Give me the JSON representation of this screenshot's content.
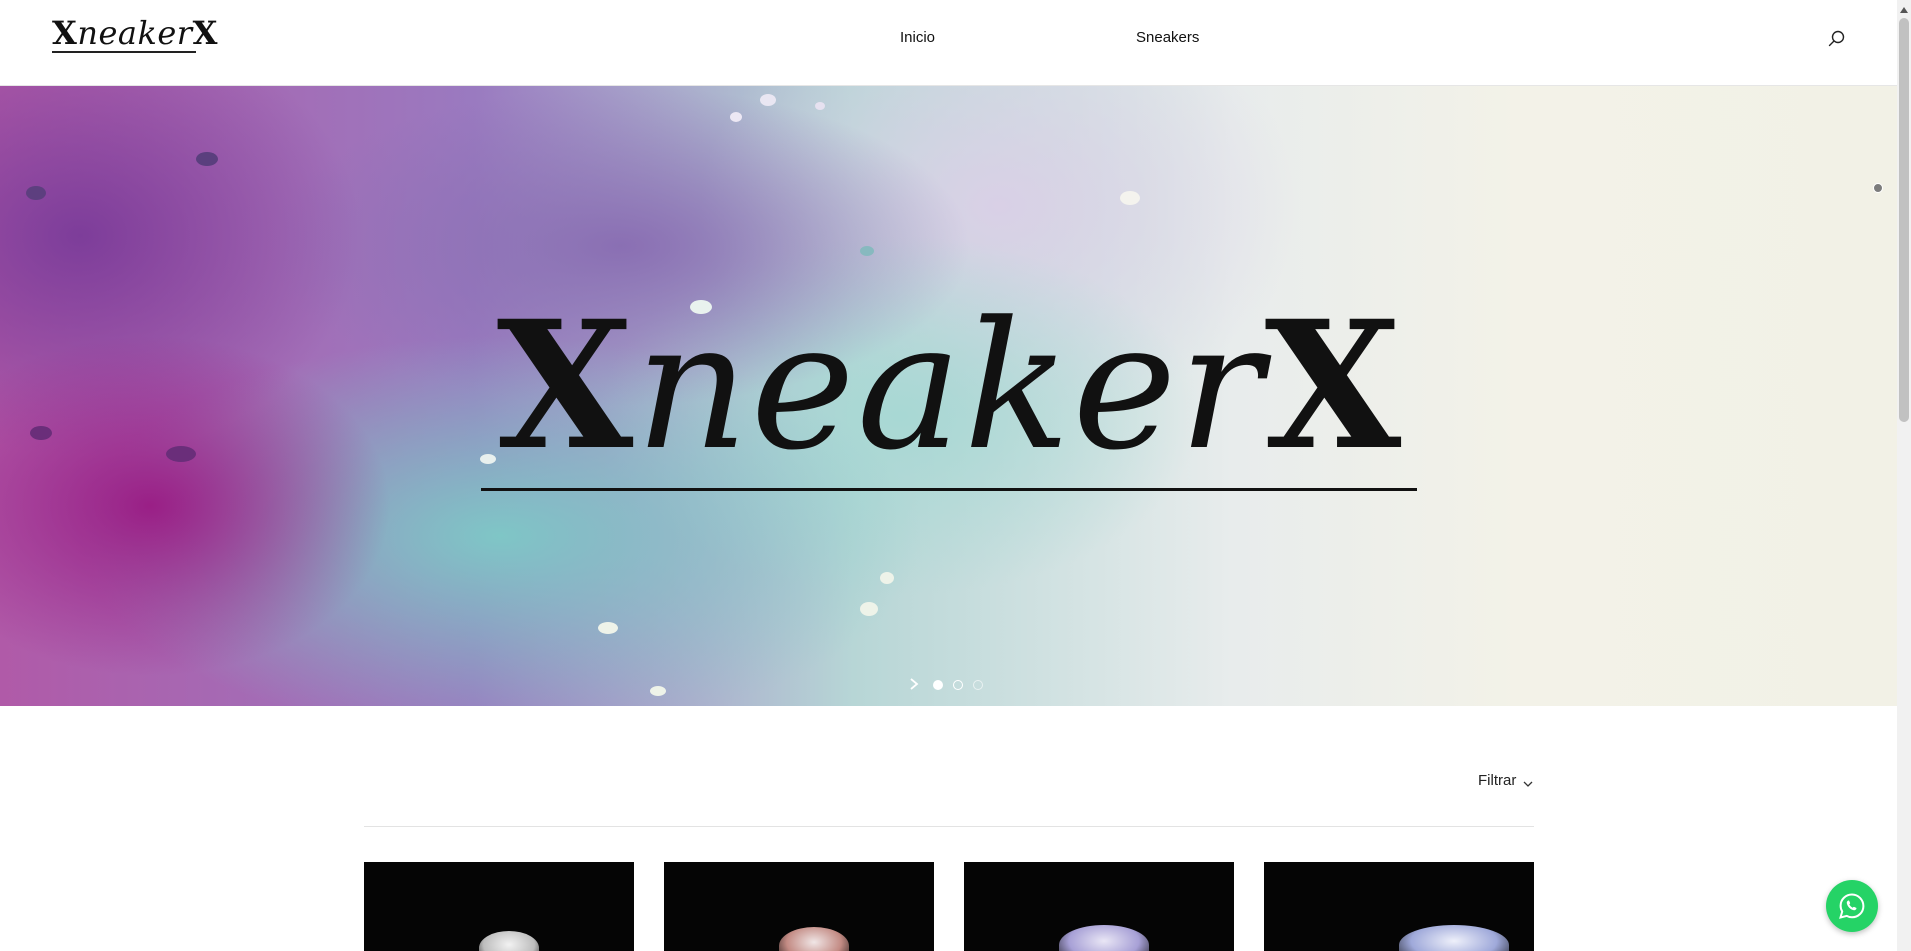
{
  "header": {
    "logo_text": "XneakerX",
    "nav": [
      {
        "label": "Inicio"
      },
      {
        "label": "Sneakers"
      }
    ],
    "search_icon": "search-icon"
  },
  "hero": {
    "logo_text": "XneakerX",
    "slides_total": 3,
    "active_slide": 1,
    "colors": {
      "magenta": "#9a1f86",
      "purple": "#8a6fb3",
      "teal": "#7fc6c6",
      "cream": "#f2f1e6"
    }
  },
  "catalog": {
    "filter_label": "Filtrar",
    "products_visible": 4
  },
  "floating": {
    "whatsapp_icon": "whatsapp-icon",
    "color": "#25d366"
  }
}
